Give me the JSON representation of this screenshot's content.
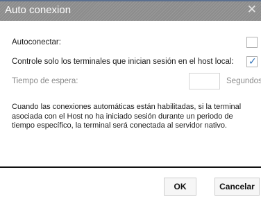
{
  "window": {
    "title": "Auto conexion",
    "close_symbol": "✕"
  },
  "form": {
    "autoconnect_label": "Autoconectar:",
    "autoconnect_checked": false,
    "local_only_label": "Controle solo los terminales que inician sesión en el host local:",
    "local_only_checked": true,
    "timeout_label": "Tiempo de espera:",
    "timeout_value": "",
    "timeout_unit": "Segundos"
  },
  "description": "Cuando las conexiones automáticas están habilitadas, si la terminal asociada con el Host no ha iniciado sesión durante un periodo de tiempo específico, la terminal será conectada al servidor nativo.",
  "buttons": {
    "ok": "OK",
    "cancel": "Cancelar"
  },
  "colors": {
    "titlebar": "#9a9a9a",
    "checkmark": "#2b6fb8"
  }
}
